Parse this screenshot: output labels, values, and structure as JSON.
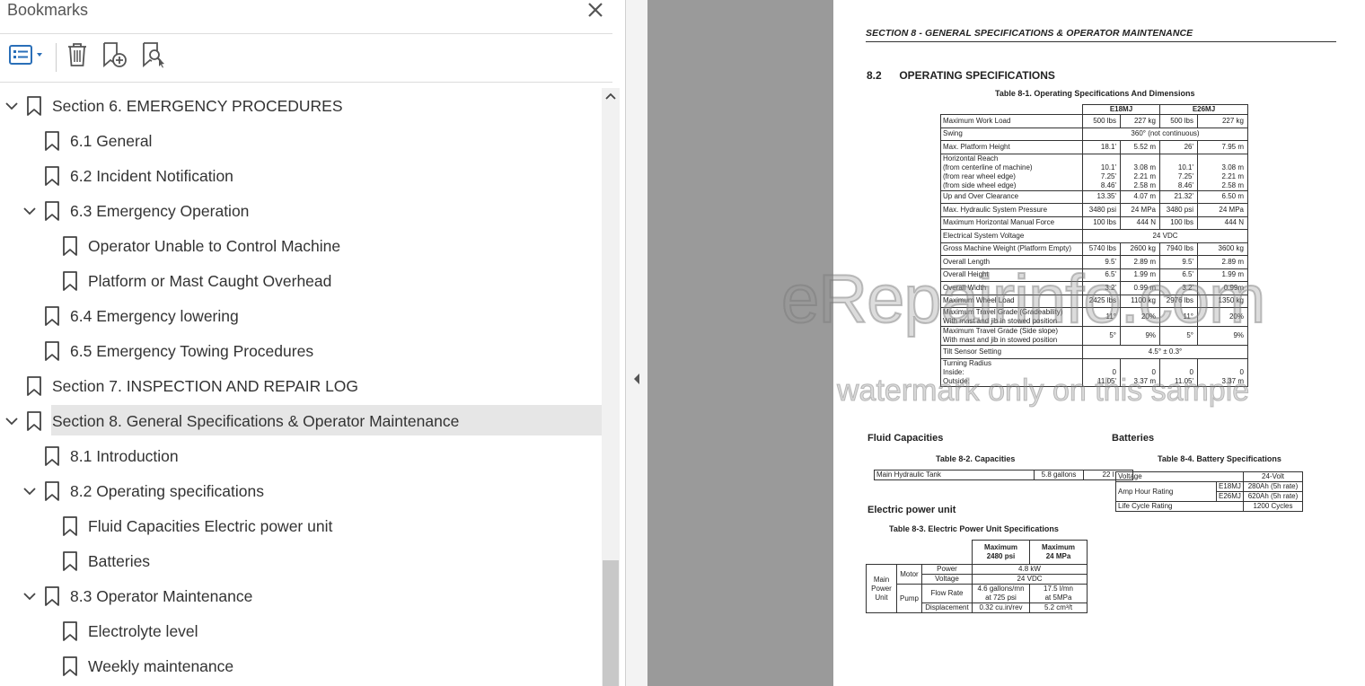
{
  "panel": {
    "title": "Bookmarks"
  },
  "colors": {
    "icon_blue": "#2a6fb8",
    "selected_bg": "#e6e6e6",
    "gray_area": "#9a9a9a"
  },
  "toolbar": {
    "options_icon": "list-options-icon",
    "delete_icon": "trash-icon",
    "new_bookmark_icon": "add-bookmark-icon",
    "find_bookmark_icon": "find-bookmark-icon"
  },
  "bookmarks": [
    {
      "label": "Section 6. EMERGENCY PROCEDURES",
      "level": 0,
      "expanded": true
    },
    {
      "label": "6.1 General",
      "level": 1
    },
    {
      "label": "6.2 Incident Notification",
      "level": 1
    },
    {
      "label": "6.3 Emergency Operation",
      "level": 1,
      "expanded": true
    },
    {
      "label": "Operator Unable to Control Machine",
      "level": 2
    },
    {
      "label": "Platform or Mast Caught Overhead",
      "level": 2
    },
    {
      "label": "6.4 Emergency lowering",
      "level": 1
    },
    {
      "label": "6.5 Emergency Towing Procedures",
      "level": 1
    },
    {
      "label": "Section 7. INSPECTION AND REPAIR LOG",
      "level": 0
    },
    {
      "label": "Section 8. General Specifications & Operator Maintenance",
      "level": 0,
      "expanded": true,
      "selected": true
    },
    {
      "label": "8.1 Introduction",
      "level": 1
    },
    {
      "label": "8.2 Operating specifications",
      "level": 1,
      "expanded": true
    },
    {
      "label": "Fluid Capacities Electric power unit",
      "level": 2
    },
    {
      "label": "Batteries",
      "level": 2
    },
    {
      "label": "8.3 Operator Maintenance",
      "level": 1,
      "expanded": true
    },
    {
      "label": "Electrolyte level",
      "level": 2
    },
    {
      "label": "Weekly maintenance",
      "level": 2
    }
  ],
  "document": {
    "header": "SECTION 8 - GENERAL SPECIFICATIONS & OPERATOR MAINTENANCE",
    "section_num": "8.2",
    "section_title": "OPERATING SPECIFICATIONS",
    "table1": {
      "caption": "Table 8-1.   Operating  Specifications And Dimensions",
      "model1": "E18MJ",
      "model2": "E26MJ",
      "rows": [
        {
          "label": "Maximum Work Load",
          "v": [
            "500 lbs",
            "227 kg",
            "500 lbs",
            "227 kg"
          ]
        },
        {
          "label": "Swing",
          "span": "360° (not continuous)"
        },
        {
          "label": "Max. Platform Height",
          "v": [
            "18.1'",
            "5.52 m",
            "26'",
            "7.95 m"
          ]
        },
        {
          "label": "Horizontal Reach\n   (from centerline of machine)\n   (from rear wheel edge)\n   (from side wheel edge)",
          "v": [
            "\n10.1'\n7.25'\n8.46'",
            "\n3.08 m\n2.21 m\n2.58 m",
            "\n10.1'\n7.25'\n8.46'",
            "\n3.08 m\n2.21 m\n2.58 m"
          ]
        },
        {
          "label": "Up and Over Clearance",
          "v": [
            "13.35'",
            "4.07 m",
            "21.32'",
            "6.50 m"
          ]
        },
        {
          "label": "Max. Hydraulic System Pressure",
          "v": [
            "3480 psi",
            "24 MPa",
            "3480 psi",
            "24 MPa"
          ]
        },
        {
          "label": "Maximum Horizontal Manual Force",
          "v": [
            "100 lbs",
            "444 N",
            "100 lbs",
            "444 N"
          ]
        },
        {
          "label": "Electrical System Voltage",
          "span": "24 VDC"
        },
        {
          "label": "Gross Machine Weight (Platform Empty)",
          "v": [
            "5740 lbs",
            "2600 kg",
            "7940 lbs",
            "3600 kg"
          ]
        },
        {
          "label": "Overall Length",
          "v": [
            "9.5'",
            "2.89 m",
            "9.5'",
            "2.89 m"
          ]
        },
        {
          "label": "Overall Height",
          "v": [
            "6.5'",
            "1.99 m",
            "6.5'",
            "1.99 m"
          ]
        },
        {
          "label": "Overall Width",
          "v": [
            "3.2'",
            "0.99 m",
            "3.2'",
            "0.99m"
          ]
        },
        {
          "label": "Maximum Wheel Load",
          "v": [
            "2425 lbs",
            "1100 kg",
            "2976 lbs",
            "1350 kg"
          ]
        },
        {
          "label": "Maximum Travel Grade (Gradeability)\nWith mast and jib in stowed position",
          "v": [
            "11°",
            "20%",
            "11°",
            "20%"
          ]
        },
        {
          "label": "Maximum Travel Grade (Side slope)\nWith mast and jib in stowed position",
          "v": [
            "5°",
            "9%",
            "5°",
            "9%"
          ]
        },
        {
          "label": "Tilt Sensor Setting",
          "span": "4.5° ± 0.3°"
        },
        {
          "label": "Turning Radius\n   Inside:\n   Outside:",
          "v": [
            "\n0\n11.05'",
            "\n0\n3.37 m",
            "\n0\n11.05'",
            "\n0\n3.37 m"
          ]
        }
      ]
    },
    "fluid": {
      "heading": "Fluid Capacities",
      "caption": "Table 8-2.   Capacities",
      "label": "Main Hydraulic Tank",
      "v1": "5.8 gallons",
      "v2": "22 l"
    },
    "battery": {
      "heading": "Batteries",
      "caption": "Table 8-4.   Battery Specifications",
      "voltage_label": "Voltage",
      "voltage": "24-Volt",
      "amp_label": "Amp Hour Rating",
      "m1": "E18MJ",
      "m1v": "280Ah (5h rate)",
      "m2": "E26MJ",
      "m2v": "620Ah (5h rate)",
      "life_label": "Life Cycle Rating",
      "life": "1200 Cycles"
    },
    "epu": {
      "heading": "Electric power unit",
      "caption": "Table 8-3.   Electric Power Unit Specifications",
      "col1": "Maximum\n2480 psi",
      "col2": "Maximum\n24 MPa",
      "main": "Main\nPower\nUnit",
      "motor": "Motor",
      "pump": "Pump",
      "power_label": "Power",
      "power": "4.8 kW",
      "volt_label": "Voltage",
      "volt": "24 VDC",
      "flow_label": "Flow Rate",
      "flow1": "4.6 gallons/mn\nat 725 psi",
      "flow2": "17.5 l/mn\nat 5MPa",
      "disp_label": "Displacement",
      "disp1": "0.32 cu.in/rev",
      "disp2": "5.2 cm³/t"
    },
    "watermark": "eRepairinfo.com",
    "watermark_sub": "watermark only on this sample"
  }
}
